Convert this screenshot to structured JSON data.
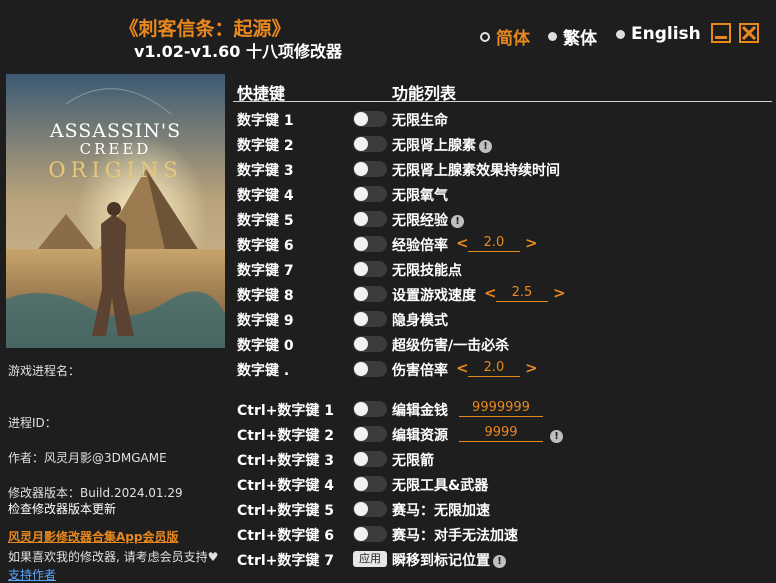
{
  "header": {
    "game_title": "《刺客信条：起源》",
    "subtitle": "v1.02-v1.60 十八项修改器"
  },
  "languages": [
    {
      "label": "简体",
      "active": true
    },
    {
      "label": "繁体",
      "active": false
    },
    {
      "label": "English",
      "active": false
    }
  ],
  "cover": {
    "line1": "ASSASSIN'S",
    "line2": "CREED",
    "line3": "ORIGINS"
  },
  "info": {
    "process_name_label": "游戏进程名：",
    "process_id_label": "进程ID：",
    "author": "作者：风灵月影@3DMGAME",
    "version": "修改器版本：Build.2024.01.29",
    "check_update": "检查修改器版本更新",
    "promo": "风灵月影修改器合集App会员版",
    "support_text": "如果喜欢我的修改器, 请考虑会员支持♥",
    "support_link": "支持作者"
  },
  "columns": {
    "hotkey": "快捷键",
    "features": "功能列表"
  },
  "cheats": [
    {
      "key": "数字键 1",
      "name": "无限生命"
    },
    {
      "key": "数字键 2",
      "name": "无限肾上腺素",
      "warn": "!"
    },
    {
      "key": "数字键 3",
      "name": "无限肾上腺素效果持续时间"
    },
    {
      "key": "数字键 4",
      "name": "无限氧气"
    },
    {
      "key": "数字键 5",
      "name": "无限经验",
      "warn": "!"
    },
    {
      "key": "数字键 6",
      "name": "经验倍率",
      "value": "2.0"
    },
    {
      "key": "数字键 7",
      "name": "无限技能点"
    },
    {
      "key": "数字键 8",
      "name": "设置游戏速度",
      "value": "2.5"
    },
    {
      "key": "数字键 9",
      "name": "隐身模式"
    },
    {
      "key": "数字键 0",
      "name": "超级伤害/一击必杀"
    },
    {
      "key": "数字键 .",
      "name": "伤害倍率",
      "value": "2.0"
    },
    {
      "key": "Ctrl+数字键 1",
      "name": "编辑金钱",
      "edit": "9999999"
    },
    {
      "key": "Ctrl+数字键 2",
      "name": "编辑资源",
      "edit": "9999",
      "warn": "!"
    },
    {
      "key": "Ctrl+数字键 3",
      "name": "无限箭"
    },
    {
      "key": "Ctrl+数字键 4",
      "name": "无限工具&武器"
    },
    {
      "key": "Ctrl+数字键 5",
      "name": "赛马：无限加速"
    },
    {
      "key": "Ctrl+数字键 6",
      "name": "赛马：对手无法加速"
    },
    {
      "key": "Ctrl+数字键 7",
      "name": "瞬移到标记位置",
      "warn": "!",
      "apply": "应用"
    }
  ],
  "arrows": {
    "left": "<",
    "right": ">"
  },
  "colors": {
    "accent": "#e8891f",
    "background": "#1e1e1e",
    "link": "#5aa7ff"
  }
}
